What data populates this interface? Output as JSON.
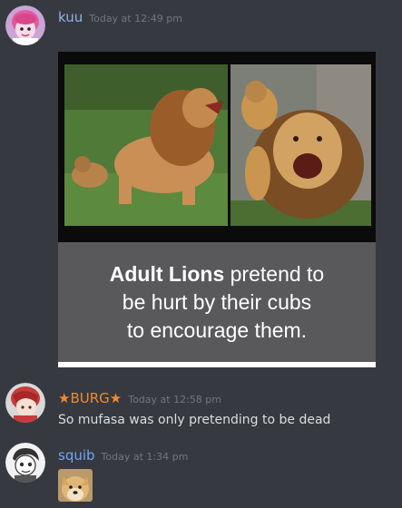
{
  "messages": [
    {
      "username": "kuu",
      "timestamp": "Today at 12:49 pm",
      "username_color": "#8fb3e8",
      "avatar": "pink-hair-character-avatar",
      "embed": {
        "caption_bold": "Adult Lions",
        "caption_rest": " pretend to\nbe hurt by their cubs\nto encourage them."
      }
    },
    {
      "username": "★BURG★",
      "timestamp": "Today at 12:58 pm",
      "username_color": "#f08a33",
      "avatar": "red-hair-character-avatar",
      "text": "So mufasa was only pretending to be dead"
    },
    {
      "username": "squib",
      "timestamp": "Today at 1:34 pm",
      "username_color": "#6ea6f5",
      "avatar": "sketch-character-avatar",
      "attachment": "doge-image"
    }
  ]
}
